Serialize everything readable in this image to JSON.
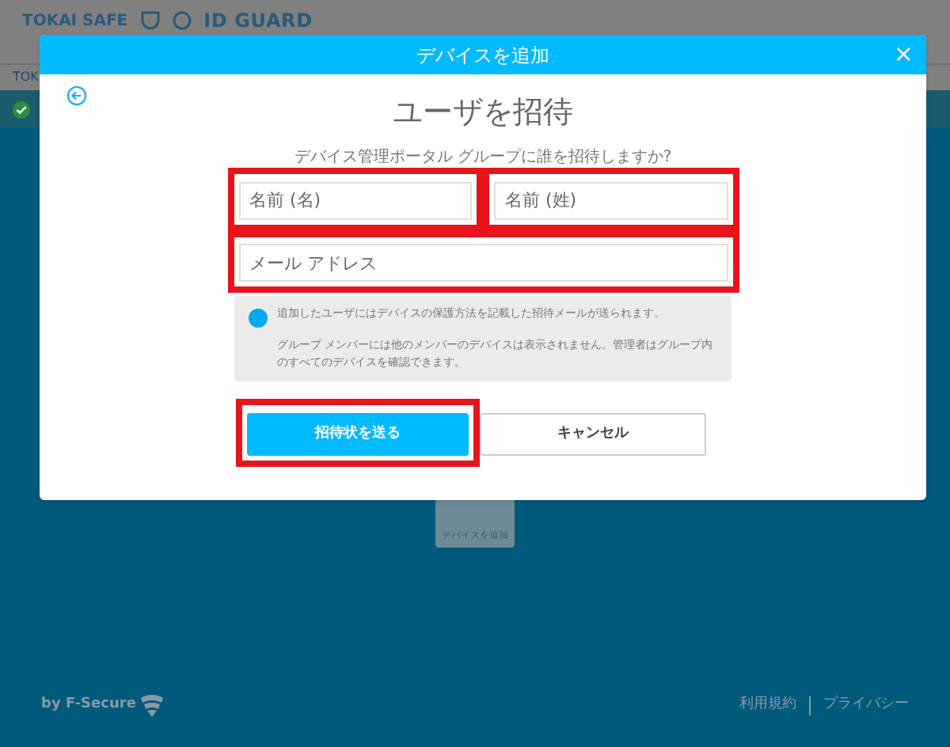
{
  "background": {
    "logo_left": "TOKAI SAFE",
    "logo_right": "ID GUARD",
    "nav_text": "TOK",
    "add_device_tile": "デバイスを追加",
    "footer": {
      "brand": "by F-Secure",
      "links": [
        "利用規約",
        "プライバシー"
      ]
    }
  },
  "dialog": {
    "title": "デバイスを追加",
    "close": "×",
    "heading": "ユーザを招待",
    "prompt": "デバイス管理ポータル グループに誰を招待しますか?",
    "fields": [
      {
        "placeholder": "名前 (名)",
        "highlighted": true
      },
      {
        "placeholder": "名前 (姓)",
        "highlighted": true
      },
      {
        "placeholder": "メール アドレス",
        "highlighted": true
      }
    ],
    "info": [
      "追加したユーザにはデバイスの保護方法を記載した招待メールが送られます。",
      "グループ メンバーには他のメンバーのデバイスは表示されません。管理者はグループ内のすべてのデバイスを確認できます。"
    ],
    "buttons": [
      {
        "label": "招待状を送る",
        "kind": "primary",
        "highlighted": true
      },
      {
        "label": "キャンセル",
        "kind": "secondary",
        "highlighted": false
      }
    ]
  }
}
